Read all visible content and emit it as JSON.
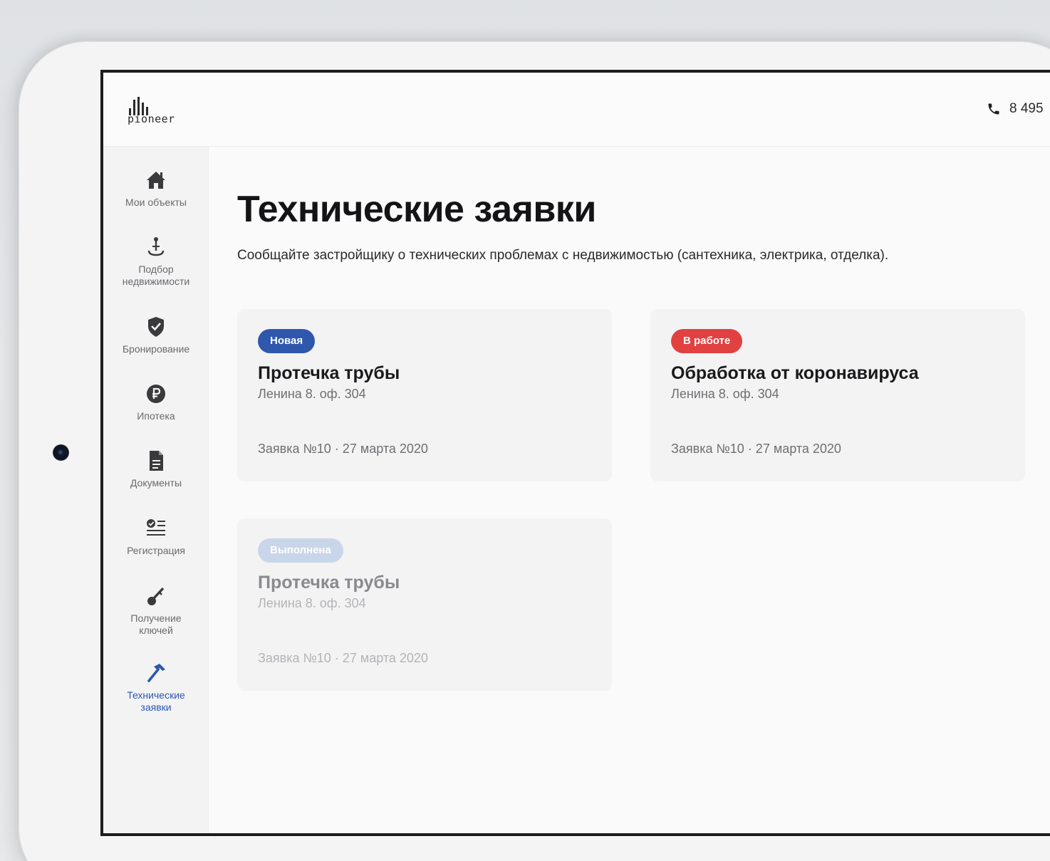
{
  "header": {
    "logo_text": "pioneer",
    "phone": "8 495"
  },
  "sidebar": {
    "items": [
      {
        "label": "Мои объекты",
        "icon": "home-icon"
      },
      {
        "label": "Подбор недвижимости",
        "icon": "map-pin-icon"
      },
      {
        "label": "Бронирование",
        "icon": "shield-check-icon"
      },
      {
        "label": "Ипотека",
        "icon": "ruble-circle-icon"
      },
      {
        "label": "Документы",
        "icon": "document-icon"
      },
      {
        "label": "Регистрация",
        "icon": "checklist-icon"
      },
      {
        "label": "Получение ключей",
        "icon": "key-icon"
      },
      {
        "label": "Технические заявки",
        "icon": "hammer-icon",
        "active": true
      }
    ]
  },
  "main": {
    "title": "Технические заявки",
    "subtitle": "Сообщайте застройщику о технических проблемах с недвижимостью (сантехника, электрика, отделка).",
    "cards": [
      {
        "status": "Новая",
        "title": "Протечка трубы",
        "address": "Ленина 8. оф. 304",
        "meta": "Заявка №10 · 27 марта 2020"
      },
      {
        "status": "В работе",
        "title": "Обработка от коронавируса",
        "address": "Ленина 8. оф. 304",
        "meta": "Заявка №10 · 27 марта 2020"
      },
      {
        "status": "Выполнена",
        "title": "Протечка трубы",
        "address": "Ленина 8. оф. 304",
        "meta": "Заявка №10 · 27 марта 2020"
      }
    ]
  },
  "colors": {
    "status_new": "#2f58ad",
    "status_in_progress": "#e14141",
    "status_done": "#c9d6ea",
    "accent": "#2d56b0"
  }
}
